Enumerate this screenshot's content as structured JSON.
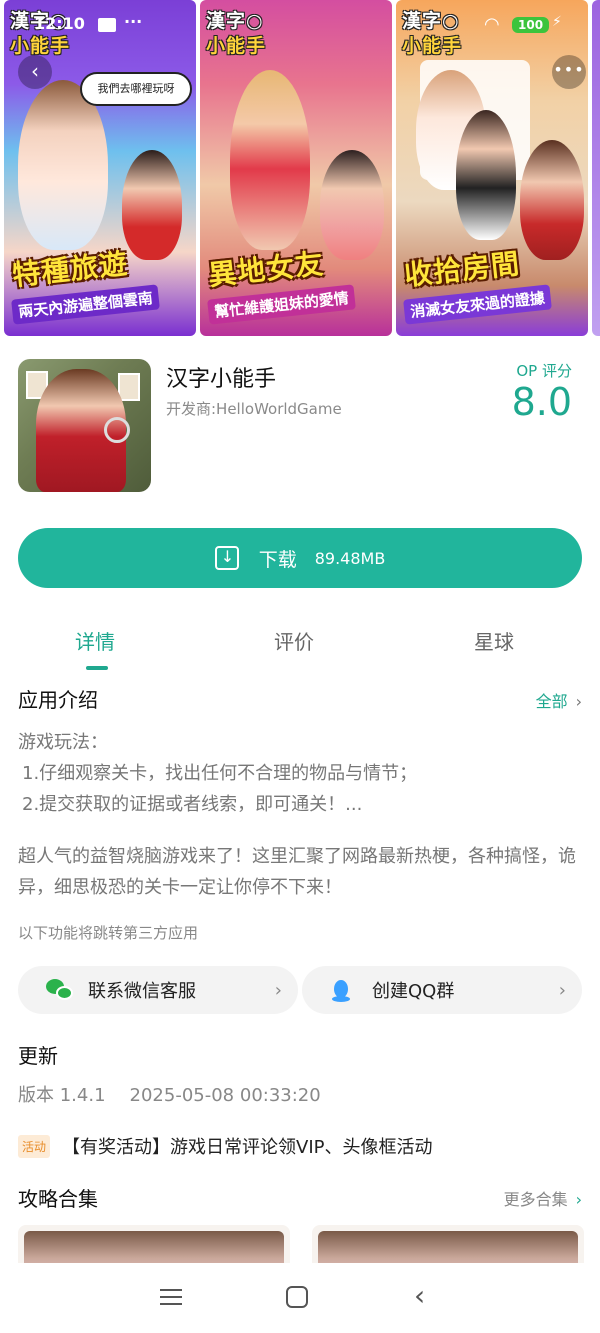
{
  "status_bar": {
    "time": "12:10",
    "dots": "···",
    "battery": "100",
    "wifi": "WiFi",
    "bolt": "⚡"
  },
  "screenshots": [
    {
      "logo_l1": "漢字○",
      "logo_l2": "小能手",
      "bubble": "我們去哪裡玩呀",
      "title": "特種旅遊",
      "subtitle": "兩天內游遍整個雲南"
    },
    {
      "logo_l1": "漢字○",
      "logo_l2": "小能手",
      "title": "異地女友",
      "subtitle": "幫忙維護姐妹的愛情"
    },
    {
      "logo_l1": "漢字○",
      "logo_l2": "小能手",
      "title": "收拾房間",
      "subtitle": "消滅女友來過的證據"
    }
  ],
  "app": {
    "name": "汉字小能手",
    "developer": "开发商:HelloWorldGame",
    "score_label": "OP 评分",
    "score": "8.0"
  },
  "download": {
    "label": "下载",
    "size": "89.48MB"
  },
  "tabs": [
    {
      "label": "详情",
      "active": true
    },
    {
      "label": "评价",
      "active": false
    },
    {
      "label": "星球",
      "active": false
    }
  ],
  "intro": {
    "title": "应用介绍",
    "all": "全部",
    "gameplay": "游戏玩法：",
    "step1": "1.仔细观察关卡，找出任何不合理的物品与情节；",
    "step2": "2.提交获取的证据或者线索，即可通关！...",
    "desc": "超人气的益智烧脑游戏来了！这里汇聚了网路最新热梗，各种搞怪，诡异，细思极恐的关卡一定让你停不下来！",
    "third_party": "以下功能将跳转第三方应用"
  },
  "links": {
    "wechat": "联系微信客服",
    "qq": "创建QQ群"
  },
  "update": {
    "title": "更新",
    "version": "版本 1.4.1",
    "date": "2025-05-08 00:33:20",
    "activity_badge": "活动",
    "activity_text": "【有奖活动】游戏日常评论领VIP、头像框活动"
  },
  "guides": {
    "title": "攻略合集",
    "more": "更多合集"
  },
  "colors": {
    "accent": "#21b59c",
    "accent_text": "#1fa88f"
  }
}
